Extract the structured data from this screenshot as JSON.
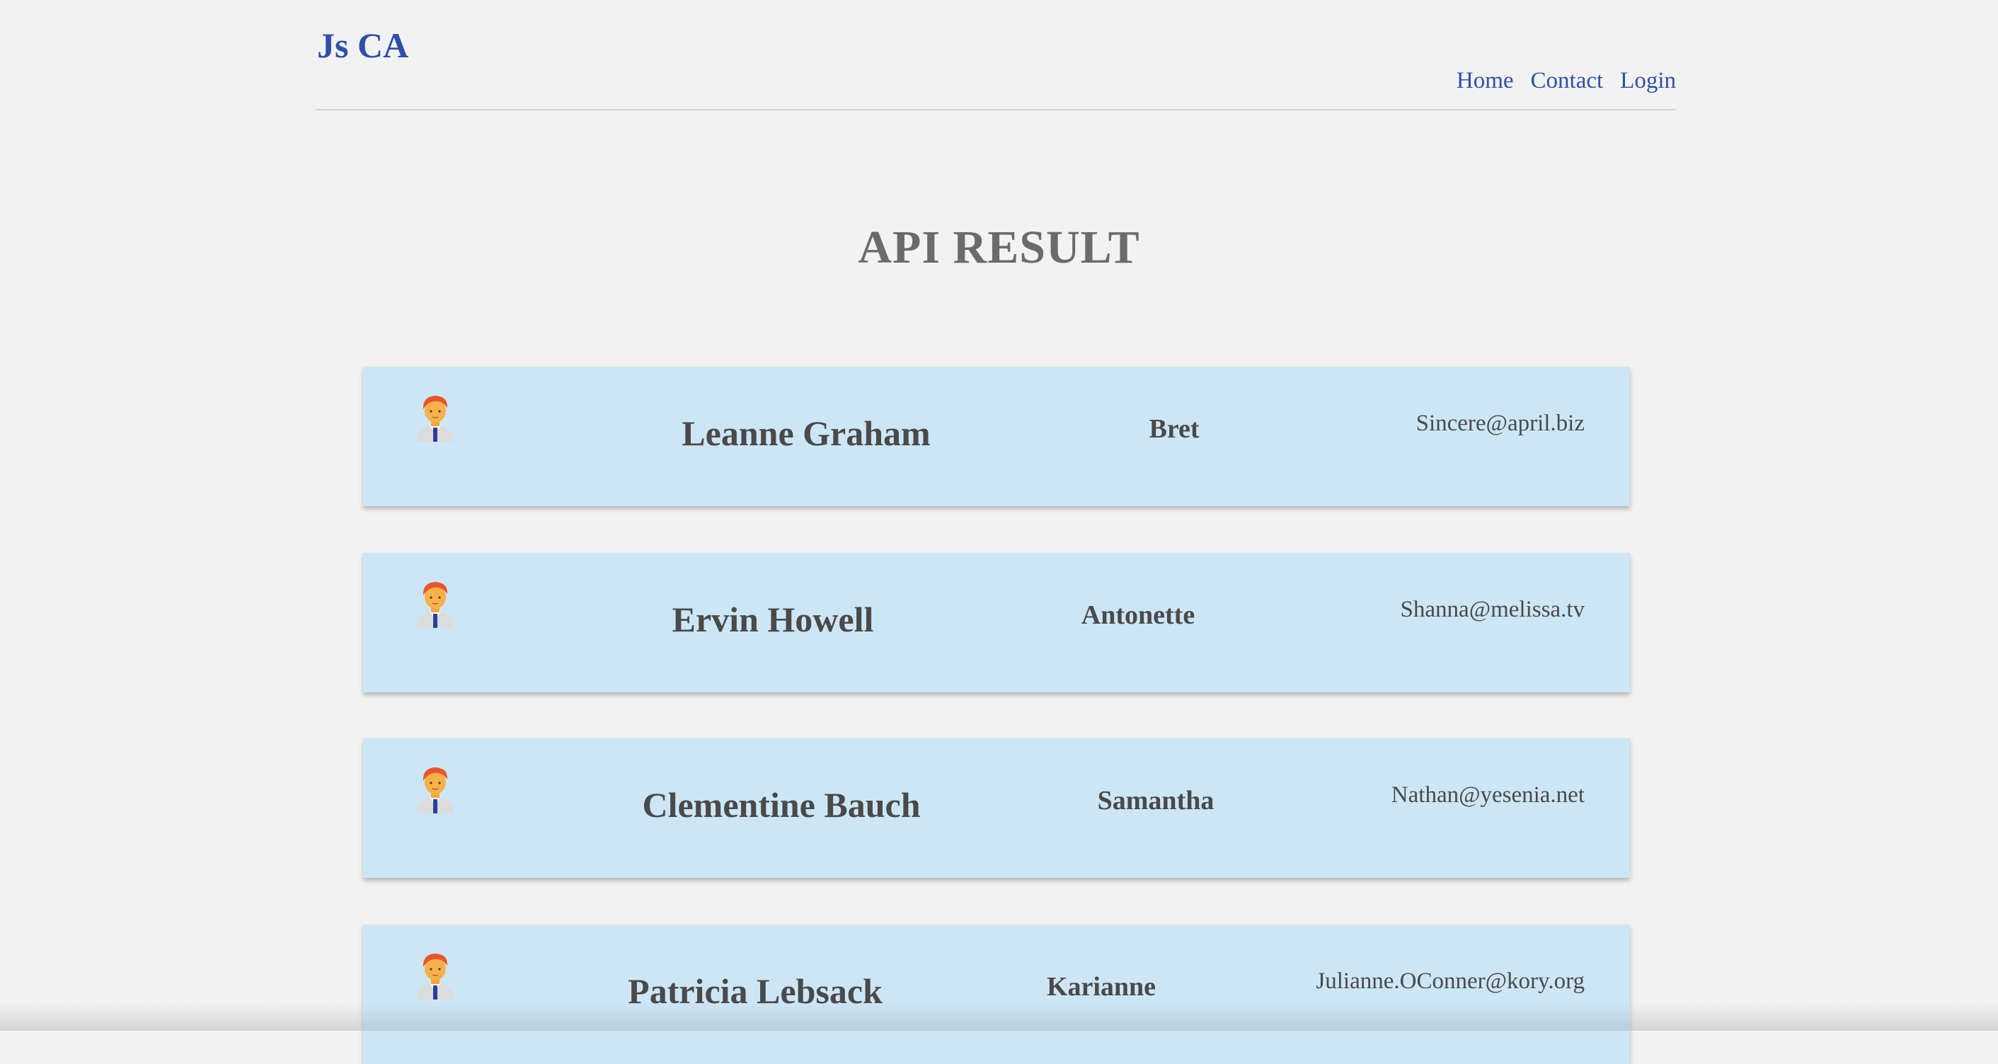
{
  "header": {
    "logo": "Js CA",
    "nav": [
      "Home",
      "Contact",
      "Login"
    ]
  },
  "main": {
    "title": "API RESULT",
    "users": [
      {
        "name": "Leanne Graham",
        "username": "Bret",
        "email": "Sincere@april.biz"
      },
      {
        "name": "Ervin Howell",
        "username": "Antonette",
        "email": "Shanna@melissa.tv"
      },
      {
        "name": "Clementine Bauch",
        "username": "Samantha",
        "email": "Nathan@yesenia.net"
      },
      {
        "name": "Patricia Lebsack",
        "username": "Karianne",
        "email": "Julianne.OConner@kory.org"
      }
    ]
  },
  "icons": {
    "avatar": "person-avatar-icon"
  },
  "colors": {
    "brand": "#2f4fa8",
    "card_background": "#cde6f5",
    "page_background": "#f3f2f2",
    "title": "#6b6b6b",
    "card_text": "#4a4a4a"
  }
}
